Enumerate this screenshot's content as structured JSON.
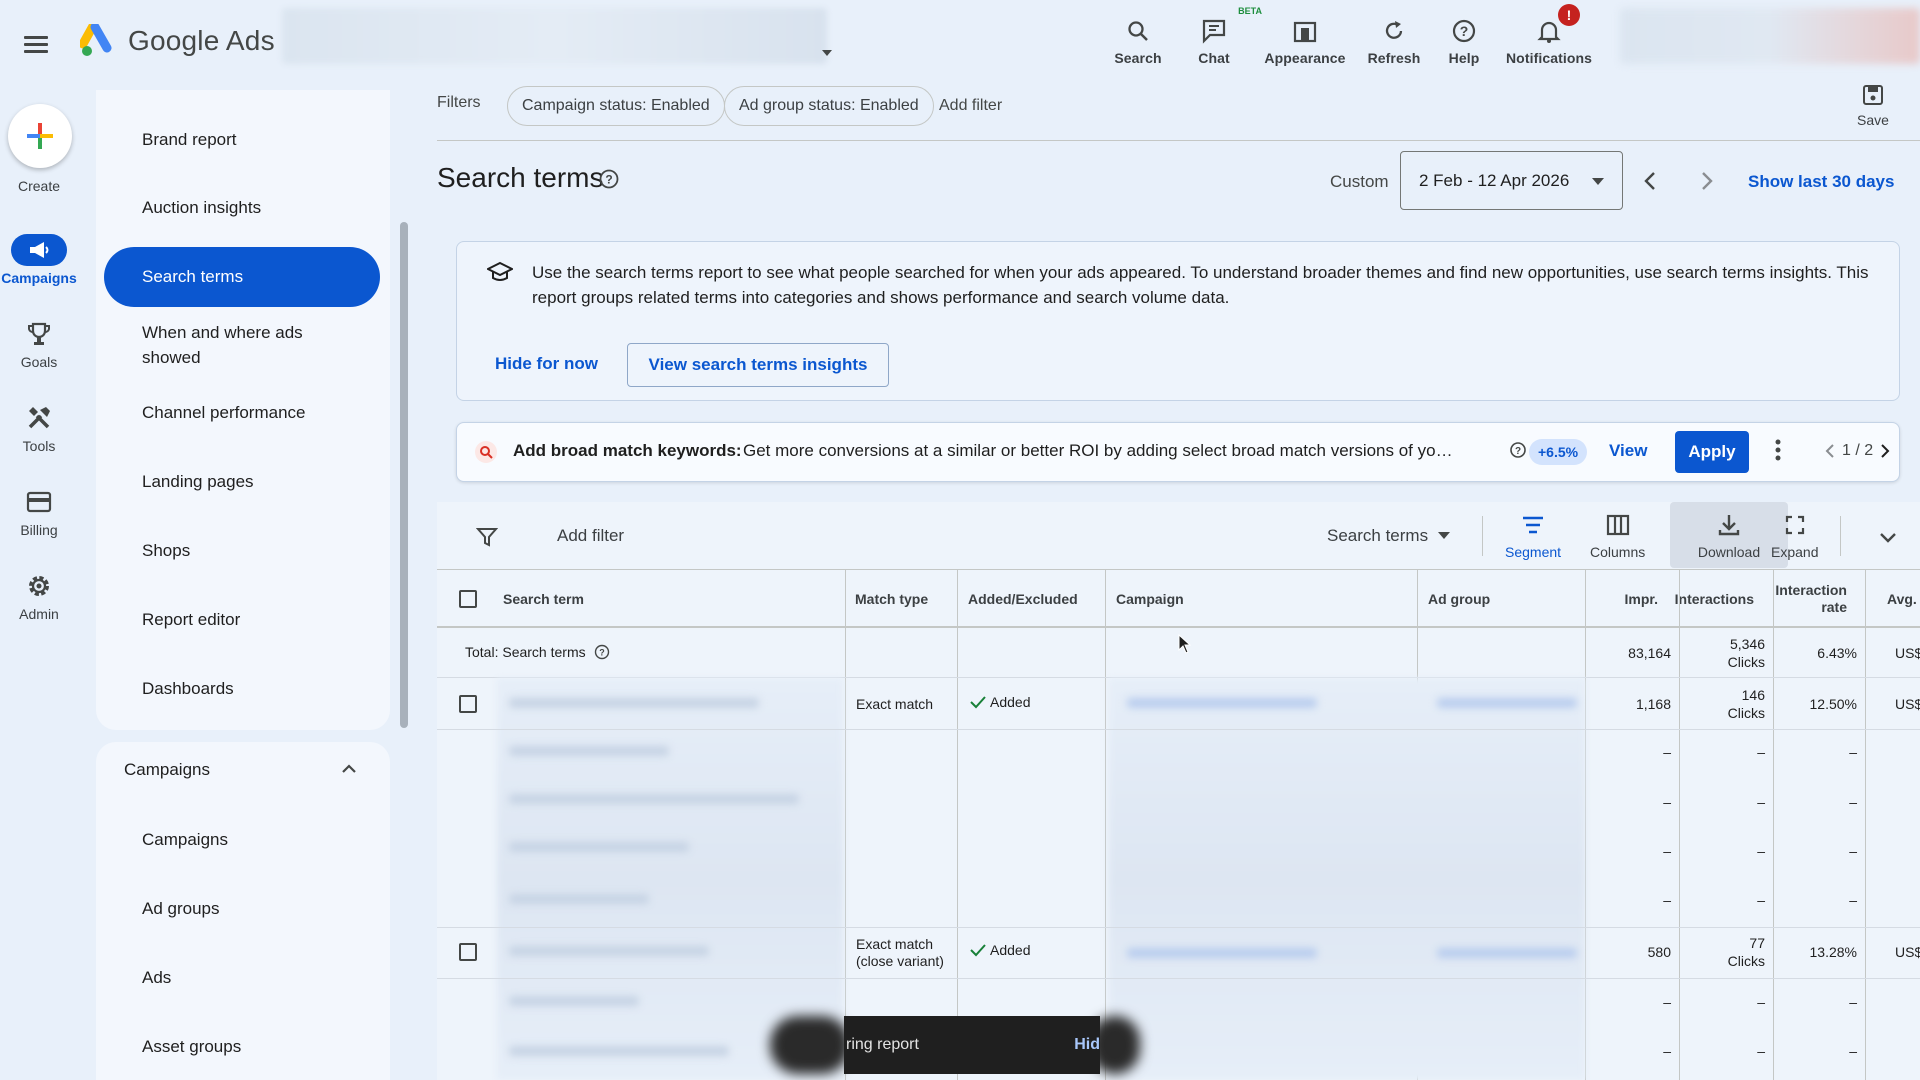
{
  "app": {
    "name": "Google Ads"
  },
  "topbar": {
    "tools": [
      {
        "label": "Search",
        "icon": "search-icon"
      },
      {
        "label": "Chat",
        "icon": "chat-icon",
        "badge": "BETA"
      },
      {
        "label": "Appearance",
        "icon": "appearance-icon"
      },
      {
        "label": "Refresh",
        "icon": "refresh-icon"
      },
      {
        "label": "Help",
        "icon": "help-icon"
      },
      {
        "label": "Notifications",
        "icon": "bell-icon",
        "badge": "!"
      }
    ]
  },
  "rail": {
    "create": "Create",
    "items": [
      {
        "label": "Campaigns",
        "icon": "campaigns-icon",
        "active": true
      },
      {
        "label": "Goals",
        "icon": "trophy-icon"
      },
      {
        "label": "Tools",
        "icon": "tools-icon"
      },
      {
        "label": "Billing",
        "icon": "billing-icon"
      },
      {
        "label": "Admin",
        "icon": "gear-icon"
      }
    ]
  },
  "sidebar": {
    "items": [
      {
        "label": "Brand report"
      },
      {
        "label": "Auction insights"
      },
      {
        "label": "Search terms",
        "active": true
      },
      {
        "label": "When and where ads showed"
      },
      {
        "label": "Channel performance"
      },
      {
        "label": "Landing pages"
      },
      {
        "label": "Shops"
      },
      {
        "label": "Report editor"
      },
      {
        "label": "Dashboards"
      }
    ],
    "section": {
      "title": "Campaigns",
      "items": [
        {
          "label": "Campaigns"
        },
        {
          "label": "Ad groups"
        },
        {
          "label": "Ads"
        },
        {
          "label": "Asset groups"
        }
      ]
    }
  },
  "filters": {
    "label": "Filters",
    "chips": [
      "Campaign status: Enabled",
      "Ad group status: Enabled"
    ],
    "add": "Add filter",
    "save": "Save"
  },
  "page": {
    "title": "Search terms",
    "date_label": "Custom",
    "date_range": "2 Feb - 12 Apr 2026",
    "show_last": "Show last 30 days"
  },
  "info_card": {
    "text": "Use the search terms report to see what people searched for when your ads appeared. To understand broader themes and find new opportunities, use search terms insights. This report groups related terms into categories and shows performance and search volume data.",
    "hide": "Hide for now",
    "cta": "View search terms insights"
  },
  "recommendation": {
    "title": "Add broad match keywords:",
    "body": "Get more conversions at a similar or better ROI by adding select broad match versions of your existi…",
    "uplift": "+6.5%",
    "view": "View",
    "apply": "Apply",
    "pager": "1 / 2"
  },
  "table": {
    "toolbar": {
      "add_filter": "Add filter",
      "view_select": "Search terms",
      "segment": "Segment",
      "columns": "Columns",
      "download": "Download",
      "expand": "Expand"
    },
    "headers": {
      "search_term": "Search term",
      "match_type": "Match type",
      "added_excluded": "Added/Excluded",
      "campaign": "Campaign",
      "ad_group": "Ad group",
      "impr": "Impr.",
      "interactions": "Interactions",
      "interaction_rate": "Interaction rate",
      "avg": "Avg."
    },
    "total": {
      "label": "Total: Search terms",
      "impr": "83,164",
      "interactions": "5,346",
      "interactions_unit": "Clicks",
      "rate": "6.43%",
      "avg": "US$"
    },
    "rows": [
      {
        "match_type": "Exact match",
        "added": "Added",
        "impr": "1,168",
        "interactions": "146",
        "interactions_unit": "Clicks",
        "rate": "12.50%",
        "avg": "US$"
      },
      {
        "match_type": "Exact match (close variant)",
        "added": "Added",
        "impr": "580",
        "interactions": "77",
        "interactions_unit": "Clicks",
        "rate": "13.28%",
        "avg": "US$"
      }
    ],
    "dash": "–"
  },
  "snackbar": {
    "text": "ring report",
    "action": "Hid"
  }
}
